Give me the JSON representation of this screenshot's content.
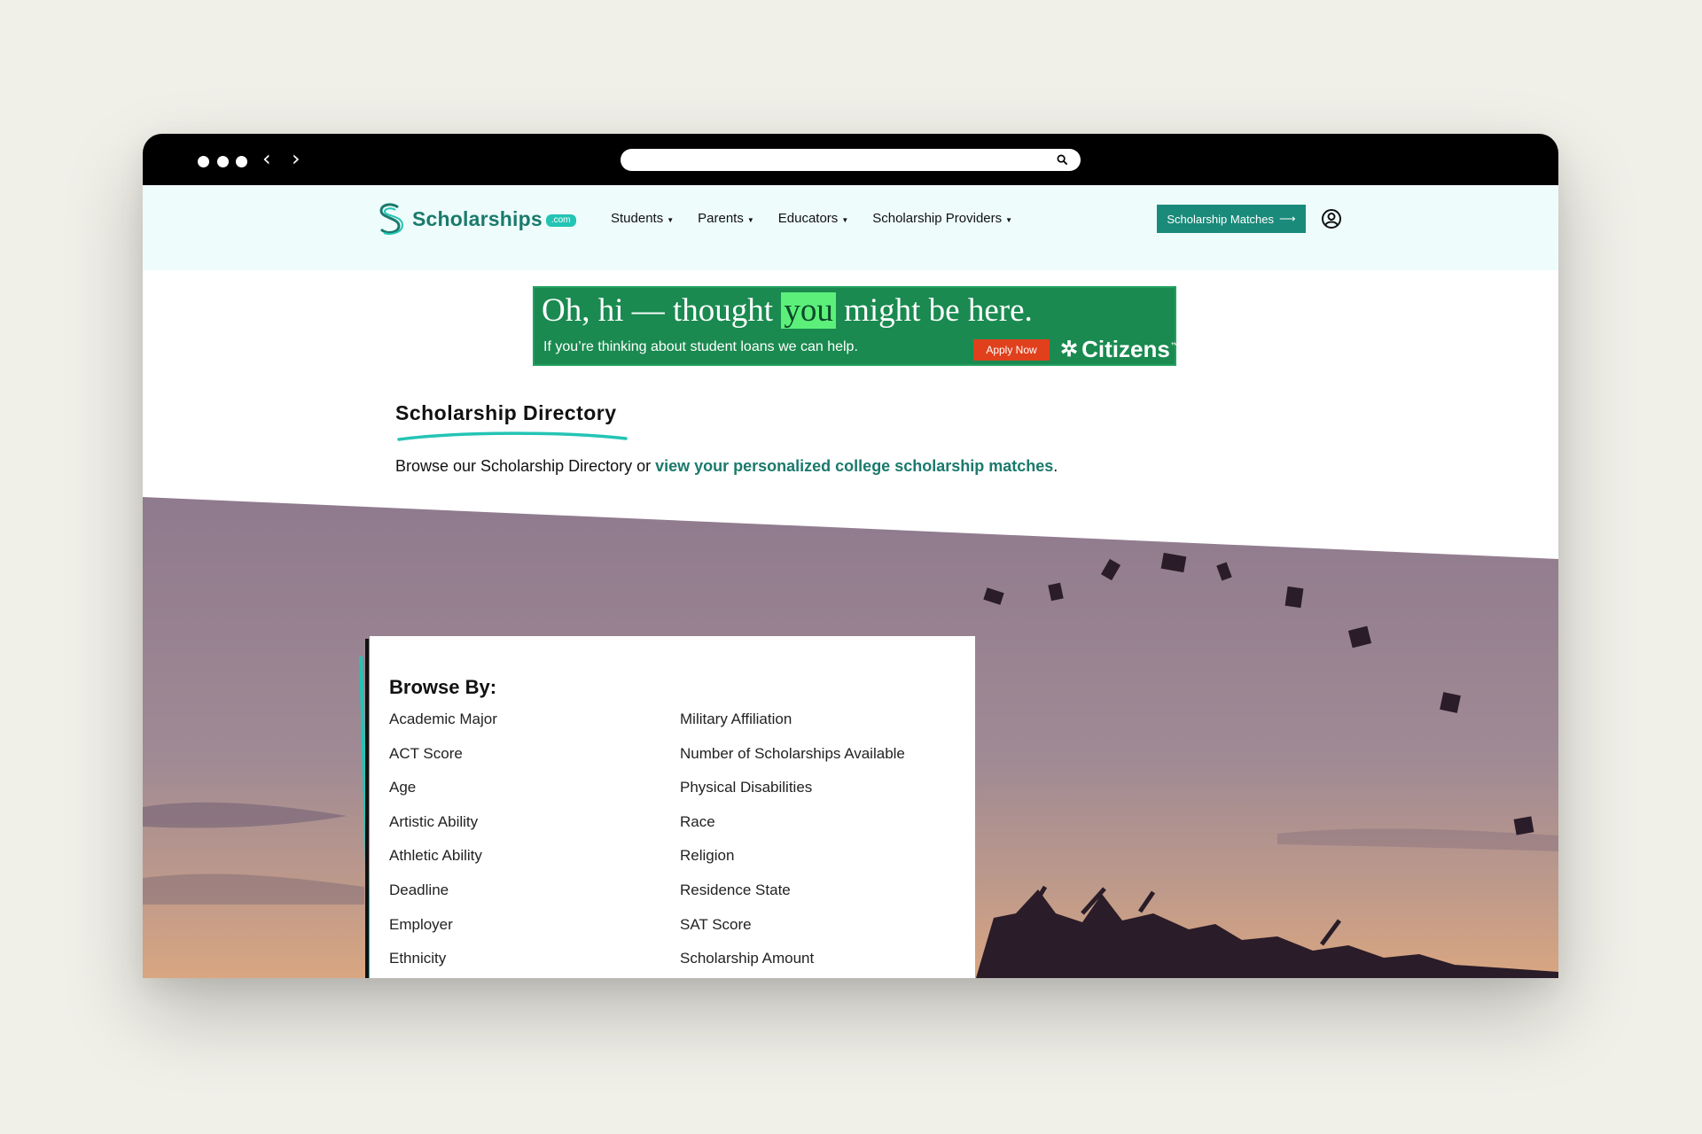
{
  "header": {
    "logo_word": "Scholarships",
    "logo_suffix": ".com",
    "menu": [
      {
        "label": "Students"
      },
      {
        "label": "Parents"
      },
      {
        "label": "Educators"
      },
      {
        "label": "Scholarship Providers"
      }
    ],
    "matches_button": "Scholarship Matches",
    "matches_arrow": "⟶"
  },
  "ad": {
    "headline_pre": "Oh, hi — thought",
    "headline_highlight": "you",
    "headline_post": "might be here.",
    "subtext": "If you’re thinking about student loans we can help.",
    "apply_label": "Apply Now",
    "brand": "Citizens",
    "brand_tm": "™"
  },
  "directory": {
    "title": "Scholarship Directory",
    "intro": "Browse our Scholarship Directory or ",
    "link_text": "view your personalized college scholarship matches",
    "intro_end": "."
  },
  "browse": {
    "title": "Browse By:",
    "left": [
      "Academic Major",
      "ACT Score",
      "Age",
      "Artistic Ability",
      "Athletic Ability",
      "Deadline",
      "Employer",
      "Ethnicity"
    ],
    "right": [
      "Military Affiliation",
      "Number of Scholarships Available",
      "Physical Disabilities",
      "Race",
      "Religion",
      "Residence State",
      "SAT Score",
      "Scholarship Amount"
    ]
  },
  "colors": {
    "brand_teal": "#1a7a6c",
    "accent_teal": "#24c4b4",
    "header_bg": "#eefcfc",
    "ad_green": "#1a8a50",
    "apply_red": "#e0401c"
  }
}
